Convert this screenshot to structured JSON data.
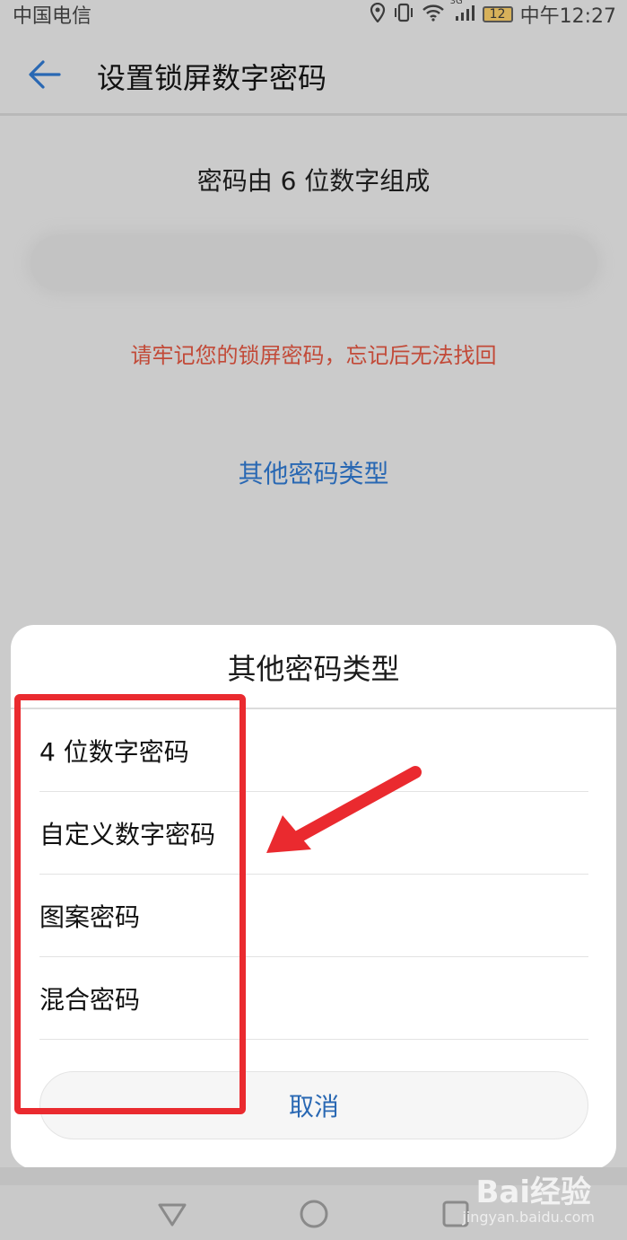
{
  "status_bar": {
    "carrier": "中国电信",
    "network": "3G",
    "battery": "12",
    "time": "中午12:27"
  },
  "app_bar": {
    "back_icon": "arrow-left-icon",
    "title": "设置锁屏数字密码"
  },
  "content": {
    "subtitle": "密码由 6 位数字组成",
    "pin_input_value": "",
    "warning": "请牢记您的锁屏密码，忘记后无法找回",
    "other_types_link": "其他密码类型"
  },
  "sheet": {
    "title": "其他密码类型",
    "options": [
      {
        "label": "4 位数字密码"
      },
      {
        "label": "自定义数字密码"
      },
      {
        "label": "图案密码"
      },
      {
        "label": "混合密码"
      }
    ],
    "cancel": "取消"
  },
  "annotation": {
    "color": "#ea2a2f",
    "shapes": [
      "red-highlight-box",
      "red-arrow"
    ]
  },
  "nav_bar": {
    "icons": [
      "back-triangle-icon",
      "home-circle-icon",
      "recents-square-icon"
    ]
  },
  "watermark": {
    "brand": "Bai经验",
    "url": "jingyan.baidu.com"
  },
  "colors": {
    "accent": "#2968b3",
    "warning": "#c24a38",
    "scrim": "#cbcbcb"
  }
}
